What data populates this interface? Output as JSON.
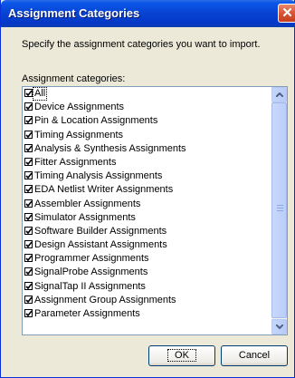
{
  "window": {
    "title": "Assignment Categories",
    "close_glyph": "✕"
  },
  "intro_text": "Specify the assignment categories you want to import.",
  "list_label": "Assignment categories:",
  "categories": [
    {
      "label": "All",
      "checked": true
    },
    {
      "label": "Device Assignments",
      "checked": true
    },
    {
      "label": "Pin & Location Assignments",
      "checked": true
    },
    {
      "label": "Timing Assignments",
      "checked": true
    },
    {
      "label": "Analysis & Synthesis Assignments",
      "checked": true
    },
    {
      "label": "Fitter Assignments",
      "checked": true
    },
    {
      "label": "Timing Analysis Assignments",
      "checked": true
    },
    {
      "label": "EDA Netlist Writer Assignments",
      "checked": true
    },
    {
      "label": "Assembler Assignments",
      "checked": true
    },
    {
      "label": "Simulator Assignments",
      "checked": true
    },
    {
      "label": "Software Builder Assignments",
      "checked": true
    },
    {
      "label": "Design Assistant Assignments",
      "checked": true
    },
    {
      "label": "Programmer Assignments",
      "checked": true
    },
    {
      "label": "SignalProbe Assignments",
      "checked": true
    },
    {
      "label": "SignalTap II Assignments",
      "checked": true
    },
    {
      "label": "Assignment Group Assignments",
      "checked": true
    },
    {
      "label": "Parameter Assignments",
      "checked": true
    }
  ],
  "buttons": {
    "ok": "OK",
    "cancel": "Cancel"
  },
  "colors": {
    "title_bar": "#0842d2",
    "dialog_bg": "#ece9d8",
    "close_button": "#d75533"
  }
}
